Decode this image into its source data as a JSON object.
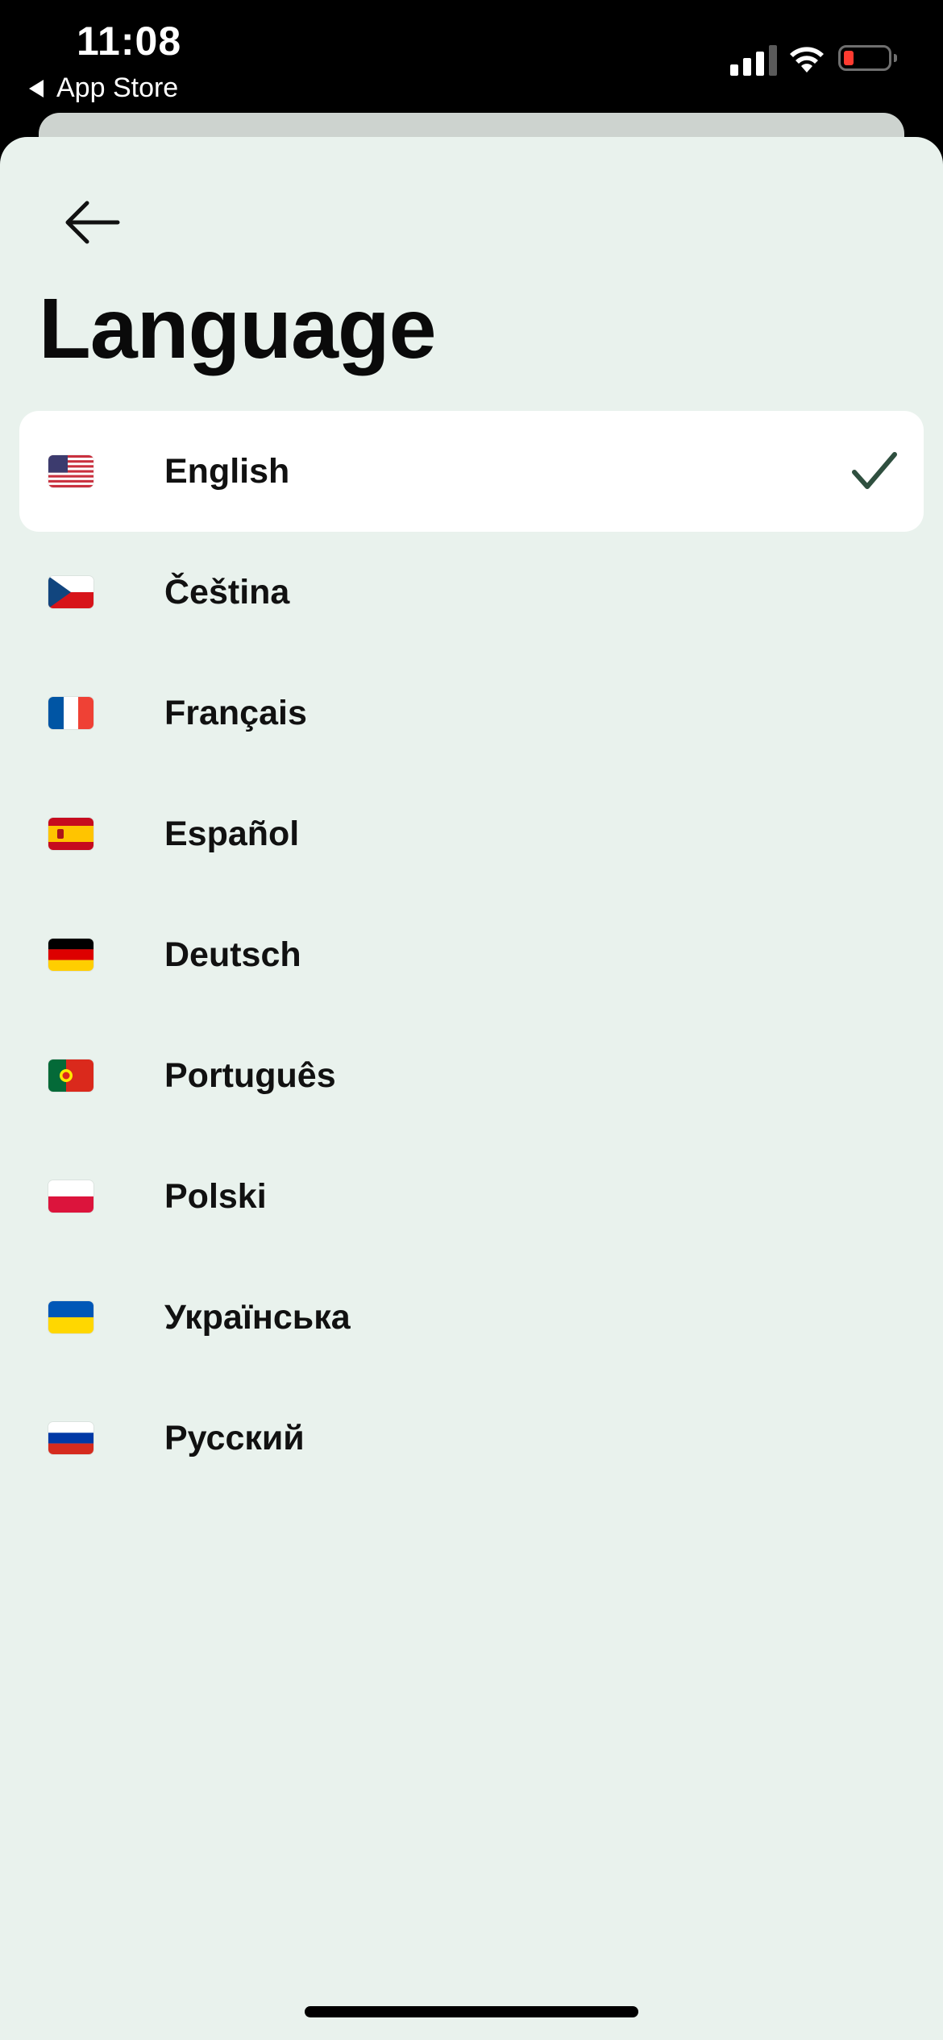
{
  "status_bar": {
    "time": "11:08",
    "back_app": "App Store",
    "signal_icon": "cellular-signal-icon",
    "wifi_icon": "wifi-icon",
    "battery_icon": "battery-low-icon"
  },
  "header": {
    "back_icon": "arrow-left-icon",
    "title": "Language"
  },
  "languages": [
    {
      "label": "English",
      "flag_icon": "flag-us-icon",
      "selected": true
    },
    {
      "label": "Čeština",
      "flag_icon": "flag-cz-icon",
      "selected": false
    },
    {
      "label": "Français",
      "flag_icon": "flag-fr-icon",
      "selected": false
    },
    {
      "label": "Español",
      "flag_icon": "flag-es-icon",
      "selected": false
    },
    {
      "label": "Deutsch",
      "flag_icon": "flag-de-icon",
      "selected": false
    },
    {
      "label": "Português",
      "flag_icon": "flag-pt-icon",
      "selected": false
    },
    {
      "label": "Polski",
      "flag_icon": "flag-pl-icon",
      "selected": false
    },
    {
      "label": "Українська",
      "flag_icon": "flag-ua-icon",
      "selected": false
    },
    {
      "label": "Русский",
      "flag_icon": "flag-ru-icon",
      "selected": false
    }
  ],
  "colors": {
    "sheet_background": "#e9f2ed",
    "selected_row": "#ffffff",
    "checkmark": "#2f4f3f",
    "battery_low": "#ff3b30"
  }
}
